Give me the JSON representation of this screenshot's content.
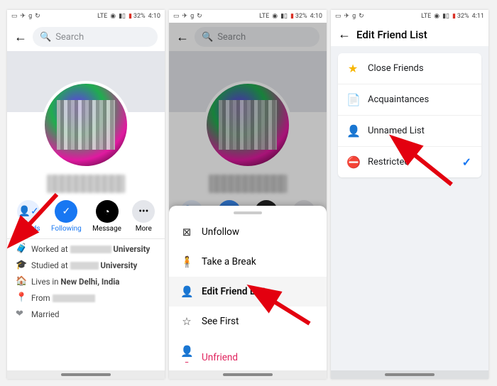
{
  "status": {
    "lte": "LTE",
    "batt_pct": "32%",
    "time_a": "4:10",
    "time_b": "4:10",
    "time_c": "4:11"
  },
  "header": {
    "search_placeholder": "Search",
    "edit_title": "Edit Friend List"
  },
  "actions": {
    "friends": "Friends",
    "following": "Following",
    "message": "Message",
    "more": "More"
  },
  "about": {
    "worked_at": "Worked at",
    "studied_at": "Studied at",
    "lives_in": "Lives in",
    "from": "From",
    "married": "Married",
    "university": "University",
    "city": "New Delhi, India"
  },
  "sheet": {
    "unfollow": "Unfollow",
    "take_break": "Take a Break",
    "edit_list": "Edit Friend List",
    "see_first": "See First",
    "unfriend": "Unfriend"
  },
  "lists": {
    "close_friends": "Close Friends",
    "acquaintances": "Acquaintances",
    "unnamed": "Unnamed List",
    "restricted": "Restricted"
  }
}
